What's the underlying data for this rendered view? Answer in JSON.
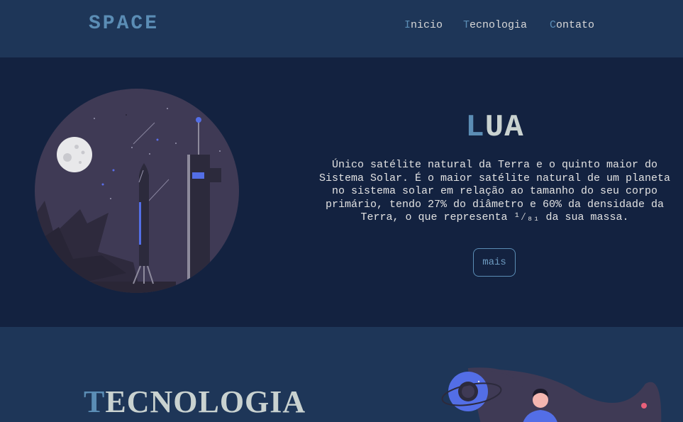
{
  "navbar": {
    "logo": "SPACE",
    "links": [
      {
        "first": "I",
        "rest": "nicio"
      },
      {
        "first": "T",
        "rest": "ecnologia"
      },
      {
        "first": "C",
        "rest": "ontato"
      }
    ]
  },
  "hero": {
    "title_first": "L",
    "title_rest": "UA",
    "description": "Único satélite natural da Terra e o quinto maior do Sistema Solar. É o maior satélite natural de um planeta no sistema solar em relação ao tamanho do seu corpo primário, tendo 27% do diâmetro e 60% da densidade da Terra, o que representa ¹⁄₈₁ da sua massa.",
    "button_label": "mais"
  },
  "tech": {
    "title_first": "T",
    "title_rest": "ECNOLOGIA"
  },
  "colors": {
    "navbar_bg": "#1e3658",
    "hero_bg": "#132240",
    "accent": "#5b8db5",
    "text": "#dcdcdc"
  }
}
